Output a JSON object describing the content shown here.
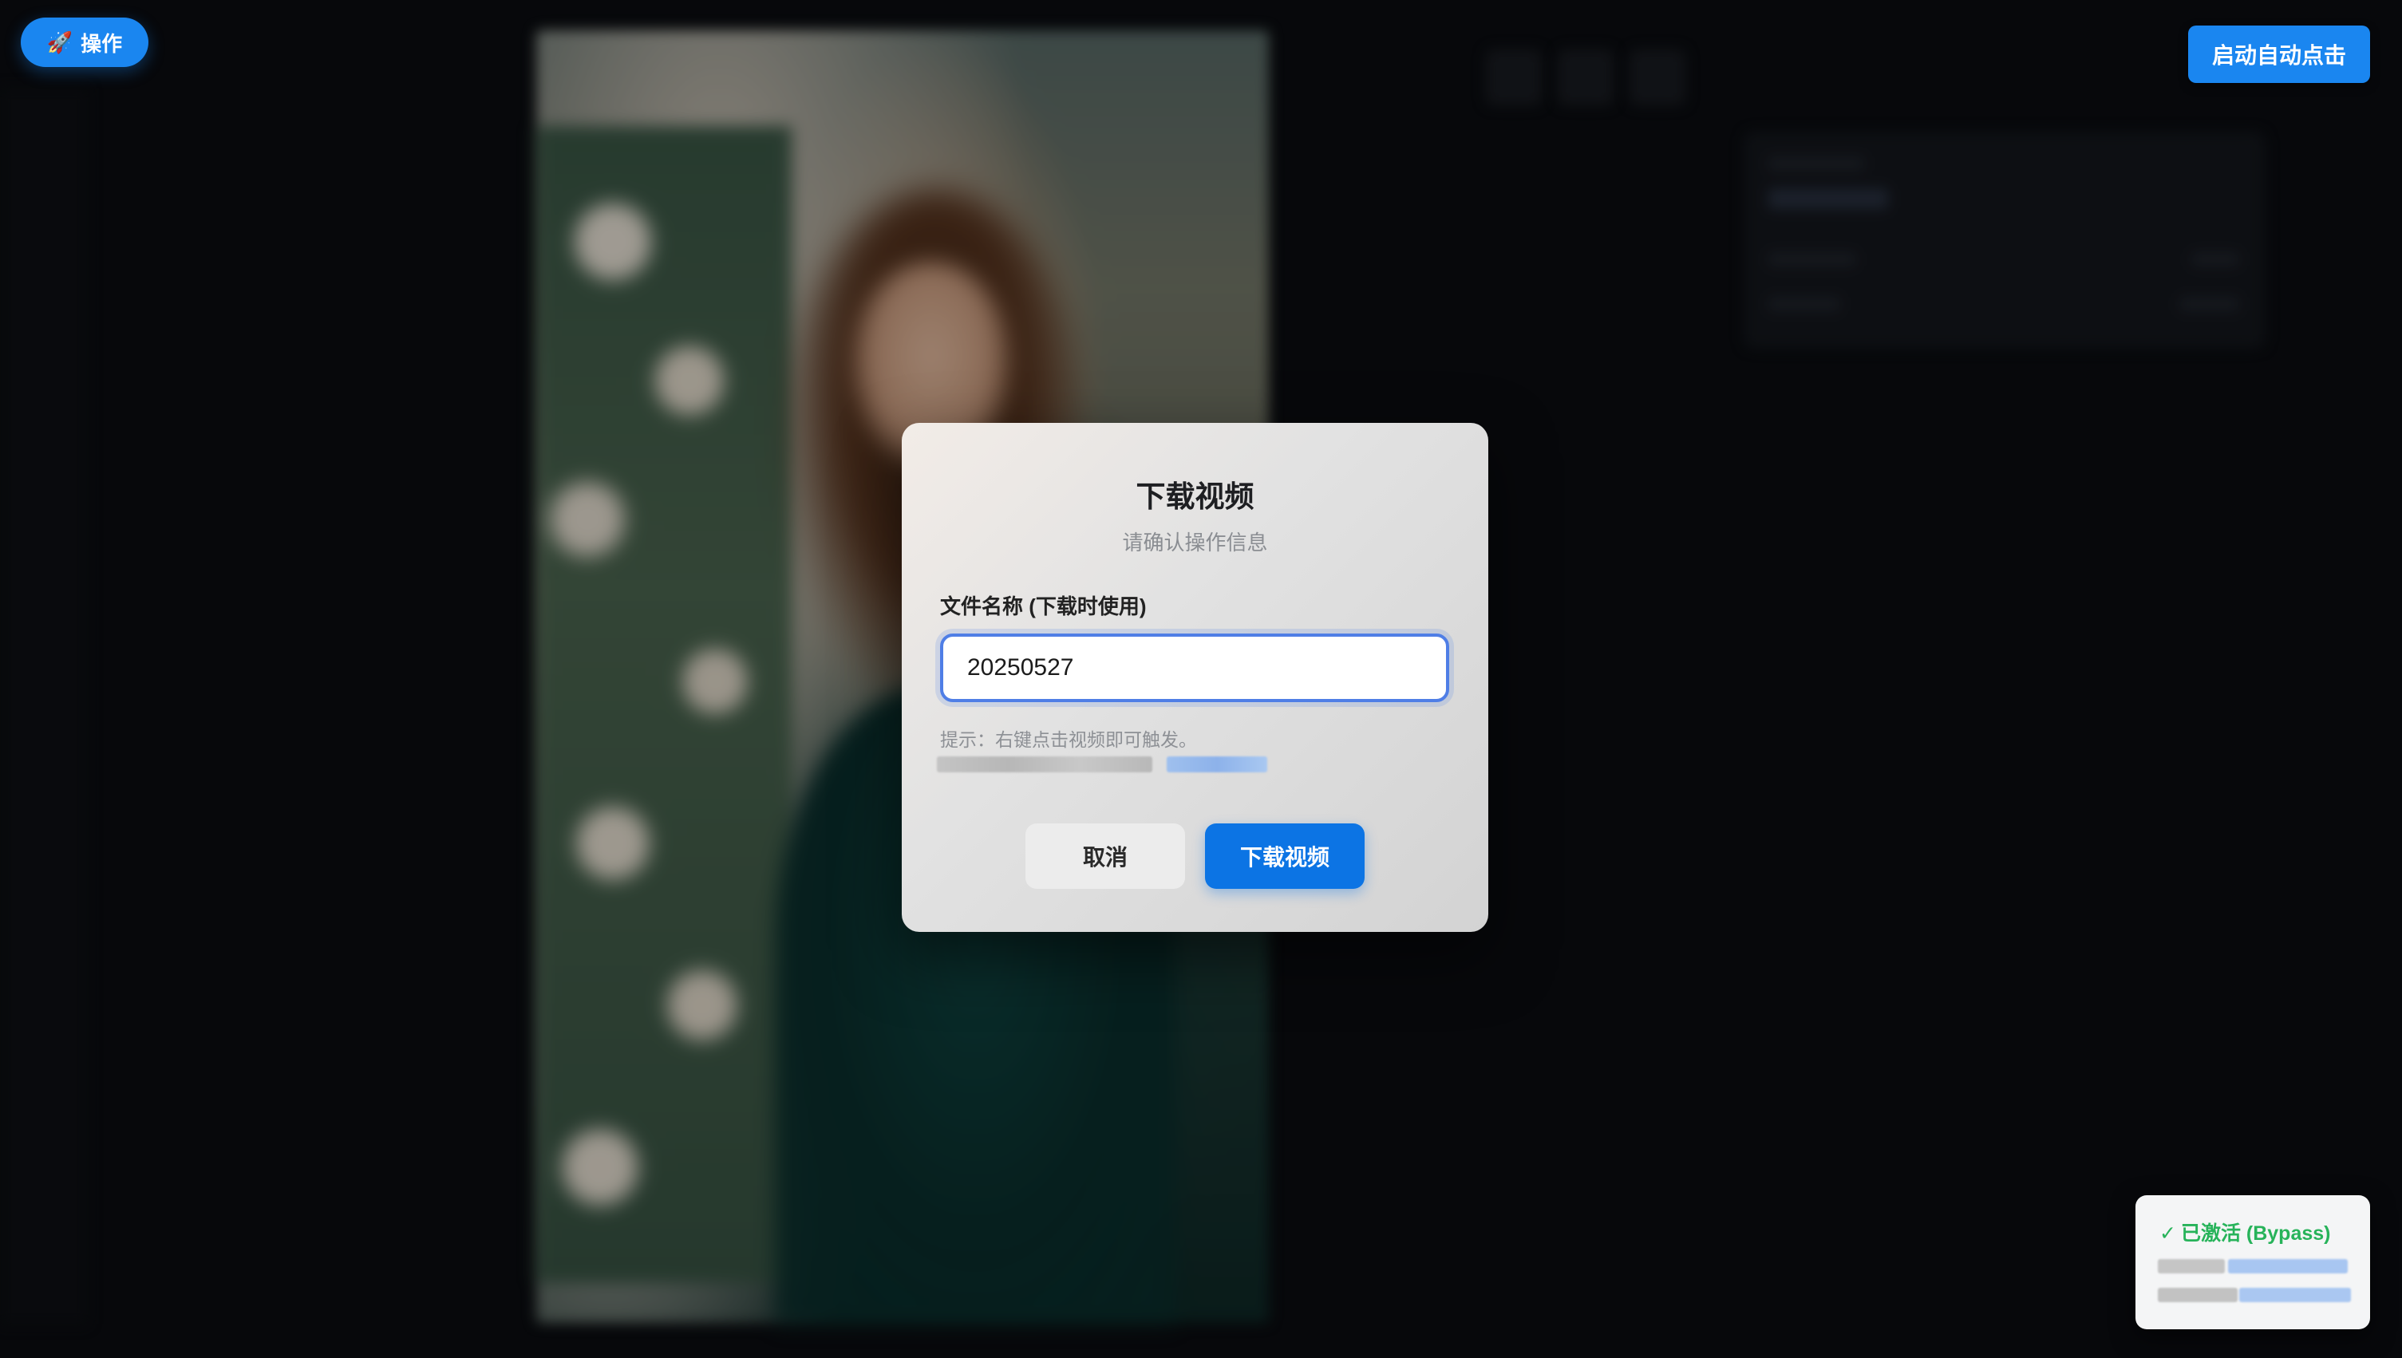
{
  "toolbar": {
    "action_pill_label": "操作",
    "action_pill_icon": "rocket-icon",
    "auto_click_label": "启动自动点击"
  },
  "dialog": {
    "title": "下载视频",
    "subtitle": "请确认操作信息",
    "filename_label": "文件名称 (下载时使用)",
    "filename_value": "20250527",
    "hint": "提示：右键点击视频即可触发。",
    "cancel_label": "取消",
    "confirm_label": "下载视频"
  },
  "status": {
    "text": "已激活 (Bypass)",
    "icon": "check-icon",
    "color": "#27b35a"
  },
  "colors": {
    "accent": "#1a86f0",
    "primary_button": "#0c74e4",
    "input_border": "#4f7ee6"
  }
}
